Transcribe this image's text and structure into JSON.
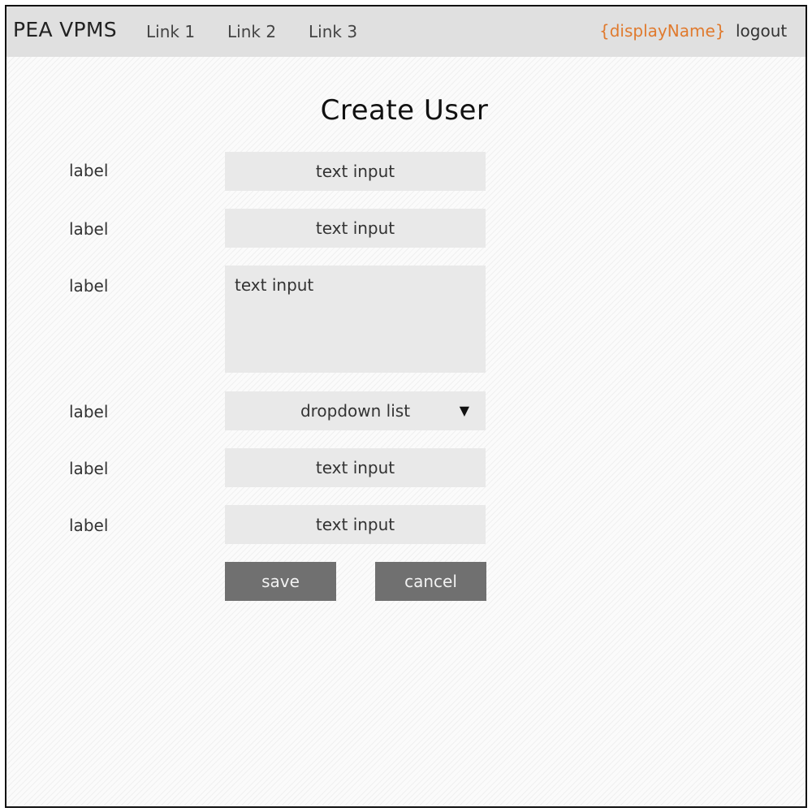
{
  "navbar": {
    "brand": "PEA VPMS",
    "links": [
      "Link 1",
      "Link 2",
      "Link 3"
    ],
    "display_name": "{displayName}",
    "logout": "logout",
    "user_color": "#e07a2e"
  },
  "page": {
    "title": "Create User"
  },
  "form": {
    "rows": [
      {
        "label": "label",
        "type": "text",
        "placeholder": "text input"
      },
      {
        "label": "label",
        "type": "text",
        "placeholder": "text input"
      },
      {
        "label": "label",
        "type": "textarea",
        "placeholder": "text input"
      },
      {
        "label": "label",
        "type": "dropdown",
        "selected": "dropdown list",
        "caret_icon": "triangle-down"
      },
      {
        "label": "label",
        "type": "text",
        "placeholder": "text input"
      },
      {
        "label": "label",
        "type": "text",
        "placeholder": "text input"
      }
    ],
    "save_label": "save",
    "cancel_label": "cancel"
  }
}
